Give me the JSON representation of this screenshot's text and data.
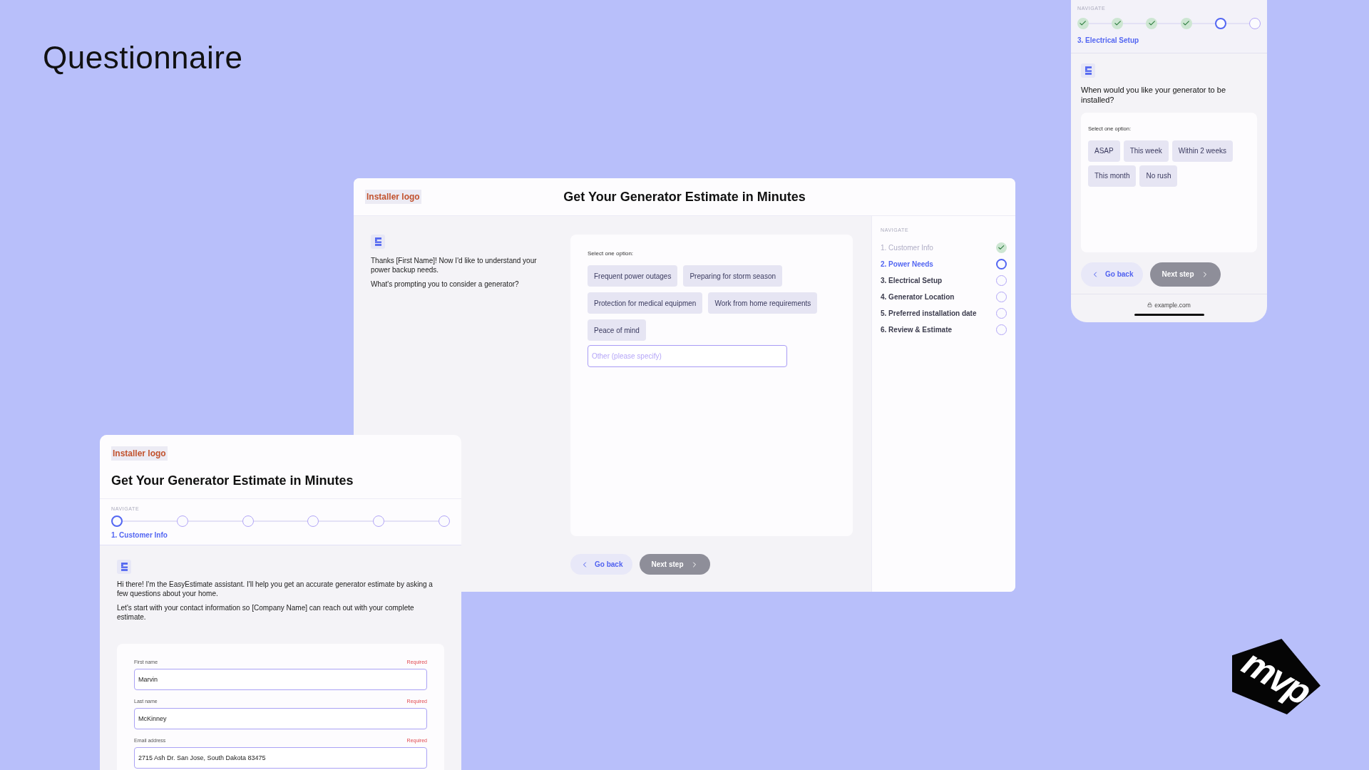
{
  "page_title": "Questionnaire",
  "desktop_view": {
    "logo": "Installer logo",
    "title": "Get Your Generator Estimate in Minutes",
    "messages": [
      "Thanks [First Name]! Now I'd like to understand your power backup needs.",
      "What's prompting you to consider a generator?"
    ],
    "prompt": "Select one option:",
    "options": [
      {
        "label": "Frequent power outages",
        "selected": false
      },
      {
        "label": "Preparing for storm season",
        "selected": false
      },
      {
        "label": "Protection for medical equipmen",
        "selected": false
      },
      {
        "label": "Work from home requirements",
        "selected": false
      },
      {
        "label": "Peace of mind",
        "selected": false
      }
    ],
    "other_placeholder": "Other (please specify)",
    "back_label": "Go back",
    "next_label": "Next step",
    "next_disabled": true,
    "nav_heading": "NAVIGATE",
    "steps": [
      {
        "label": "1. Customer Info",
        "completed": true,
        "selected": false
      },
      {
        "label": "2. Power Needs",
        "completed": false,
        "selected": true
      },
      {
        "label": "3. Electrical Setup",
        "completed": false,
        "selected": false
      },
      {
        "label": "4. Generator Location",
        "completed": false,
        "selected": false
      },
      {
        "label": "5. Preferred installation date",
        "completed": false,
        "selected": false
      },
      {
        "label": "6. Review & Estimate",
        "completed": false,
        "selected": false
      }
    ]
  },
  "mobile_view": {
    "nav_heading": "NAVIGATE",
    "steps": [
      {
        "completed": true,
        "selected": false
      },
      {
        "completed": true,
        "selected": false
      },
      {
        "completed": true,
        "selected": false
      },
      {
        "completed": true,
        "selected": false
      },
      {
        "completed": false,
        "selected": true
      },
      {
        "completed": false,
        "selected": false
      }
    ],
    "step_label": "3. Electrical Setup",
    "question": "When would you like your generator to be installed?",
    "prompt": "Select one option:",
    "options": [
      {
        "label": "ASAP",
        "selected": false
      },
      {
        "label": "This week",
        "selected": false
      },
      {
        "label": "Within 2 weeks",
        "selected": false
      },
      {
        "label": "This month",
        "selected": false
      },
      {
        "label": "No rush",
        "selected": false
      }
    ],
    "back_label": "Go back",
    "next_label": "Next step",
    "next_disabled": true,
    "url": "example.com"
  },
  "form_view": {
    "logo": "Installer logo",
    "title": "Get Your Generator Estimate in Minutes",
    "nav_heading": "NAVIGATE",
    "steps": [
      {
        "completed": false,
        "selected": true
      },
      {
        "completed": false,
        "selected": false
      },
      {
        "completed": false,
        "selected": false
      },
      {
        "completed": false,
        "selected": false
      },
      {
        "completed": false,
        "selected": false
      },
      {
        "completed": false,
        "selected": false
      }
    ],
    "step_label": "1. Customer Info",
    "messages": [
      "Hi there! I'm the EasyEstimate assistant. I'll help you get an accurate generator estimate by asking a few questions about your home.",
      "Let's start with your contact information so [Company Name] can reach out with your complete estimate."
    ],
    "fields": [
      {
        "label": "First name",
        "note": "Required",
        "value": "Marvin"
      },
      {
        "label": "Last name",
        "note": "Required",
        "value": "McKinney"
      },
      {
        "label": "Email address",
        "note": "Required",
        "value": "2715 Ash Dr. San Jose, South Dakota 83475"
      }
    ]
  },
  "brand_logo": {
    "text": "mvp"
  }
}
